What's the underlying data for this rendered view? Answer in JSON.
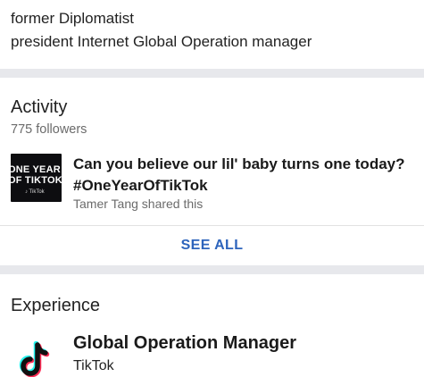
{
  "headline": {
    "line1": "former Diplomatist",
    "line2": "president Internet Global Operation manager"
  },
  "activity": {
    "title": "Activity",
    "followers": "775 followers",
    "post": {
      "thumbnail_line1": "ONE YEAR",
      "thumbnail_line2": "OF TIKTOK",
      "thumbnail_brand": "♪ TikTok",
      "text": "Can you believe our lil' baby turns one today? #OneYearOfTikTok",
      "shared_by": "Tamer Tang shared this"
    },
    "see_all": "SEE ALL"
  },
  "experience": {
    "title": "Experience",
    "items": [
      {
        "role": "Global Operation Manager",
        "company": "TikTok",
        "logo_icon": "tiktok-logo-icon"
      }
    ]
  },
  "colors": {
    "link": "#2d64bc",
    "divider": "#e7e8ec",
    "secondary_text": "#6b6b6b",
    "tiktok_cyan": "#25f4ee",
    "tiktok_red": "#fe2c55"
  }
}
